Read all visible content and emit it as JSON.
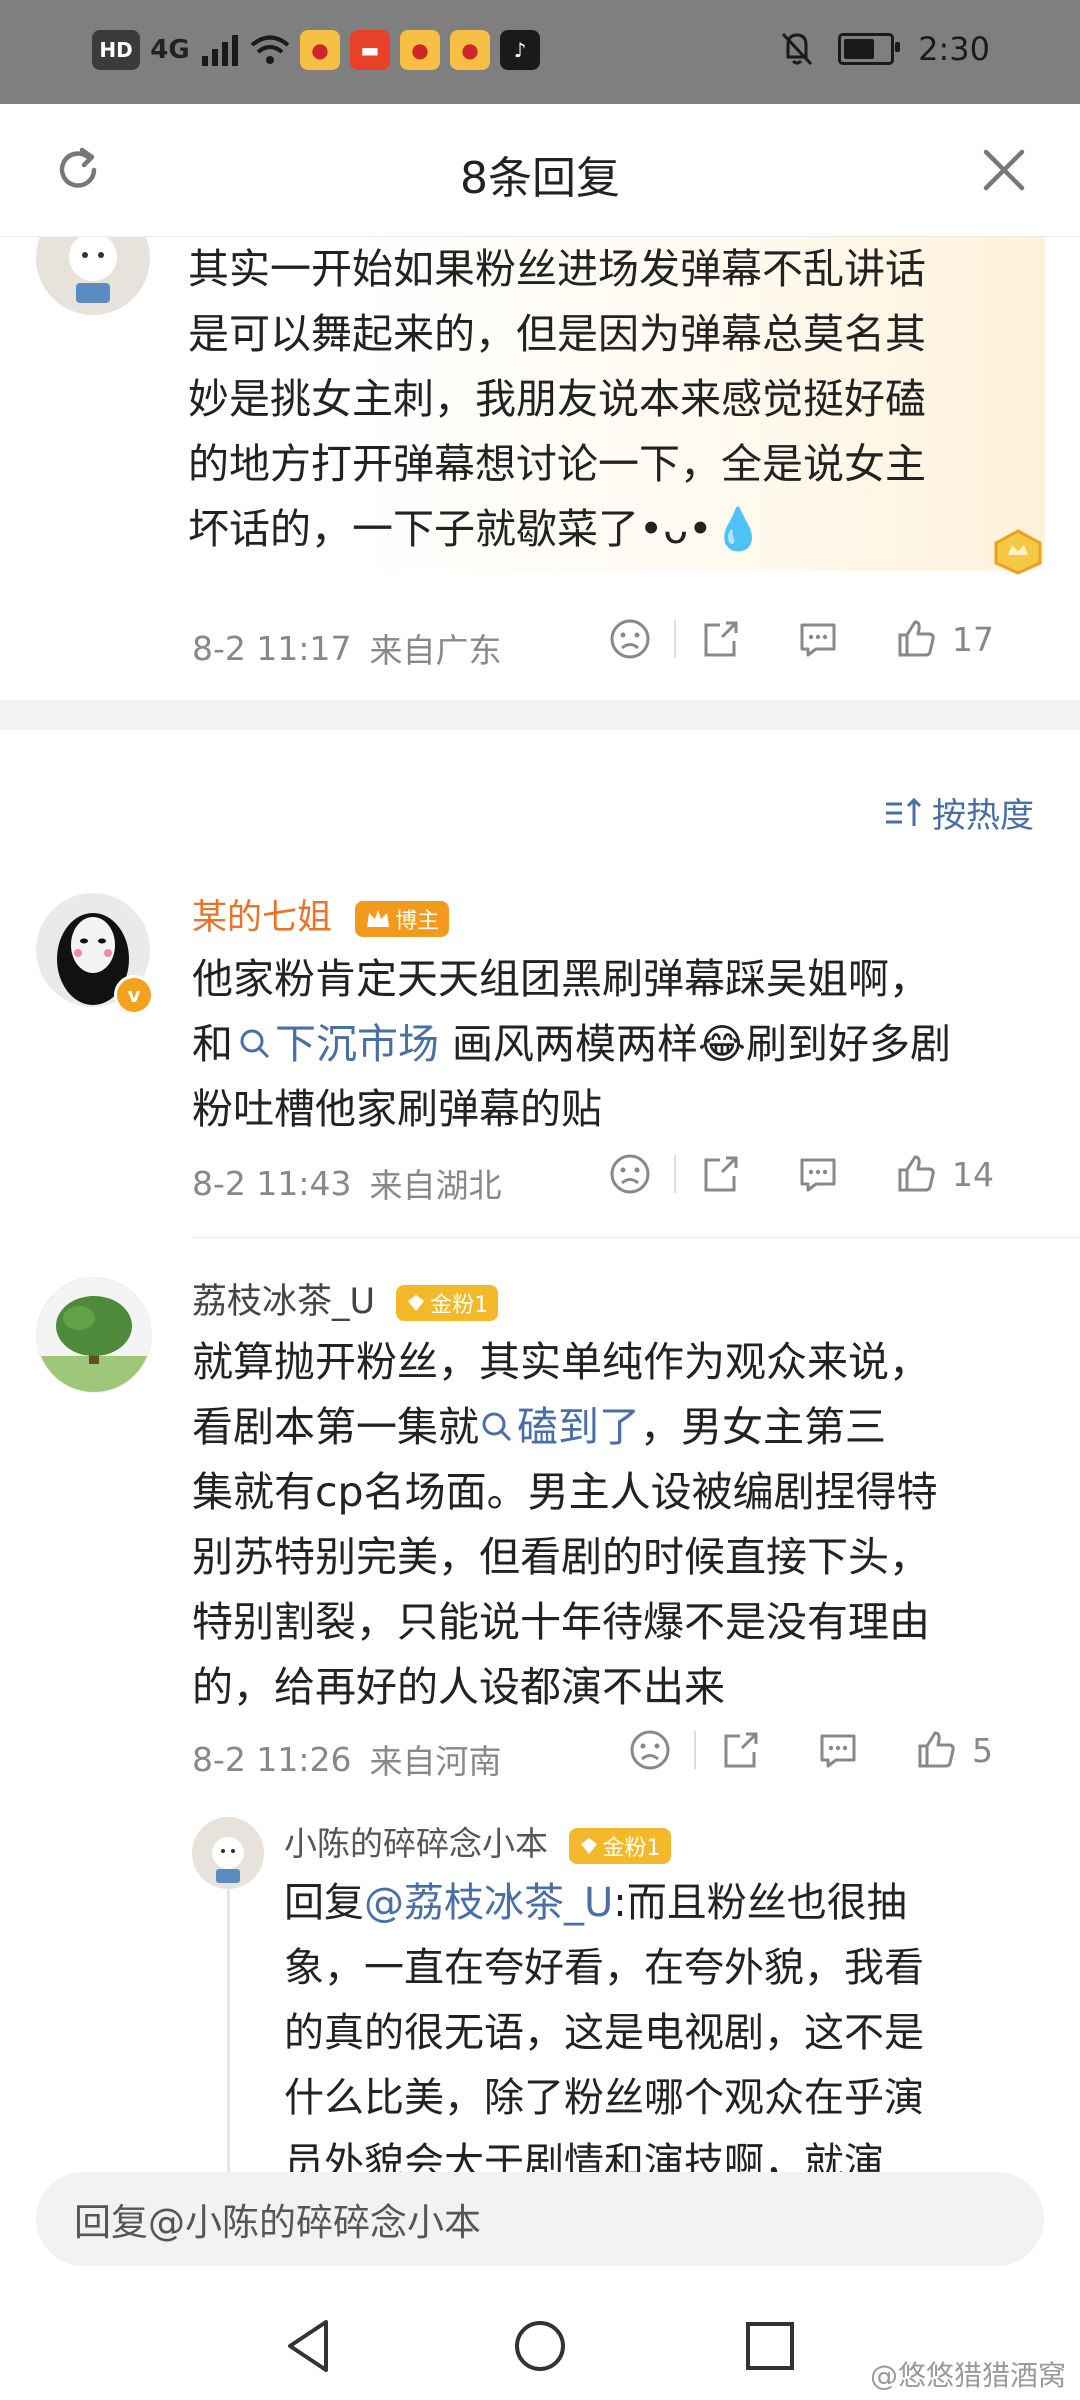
{
  "status_bar": {
    "hd": "HD",
    "network": "4G",
    "time": "2:30"
  },
  "sheet": {
    "title": "8条回复"
  },
  "comments": [
    {
      "text_lines": [
        "其实一开始如果粉丝进场发弹幕不乱讲话",
        "是可以舞起来的，但是因为弹幕总莫名其",
        "妙是挑女主刺，我朋友说本来感觉挺好磕",
        "的地方打开弹幕想讨论一下，全是说女主",
        "坏话的，一下子就歇菜了•ᴗ•💧"
      ],
      "date": "8-2 11:17",
      "location": "来自广东",
      "likes": "17"
    },
    {
      "username": "某的七姐",
      "badge": "博主",
      "text_line1": "他家粉肯定天天组团黑刷弹幕踩吴姐啊，",
      "text_line2_pre": "和",
      "text_line2_link": "下沉市场",
      "text_line2_post": " 画风两模两样😂刷到好多剧",
      "text_line3": "粉吐槽他家刷弹幕的贴",
      "date": "8-2 11:43",
      "location": "来自湖北",
      "likes": "14"
    },
    {
      "username": "荔枝冰茶_U",
      "badge": "金粉1",
      "text_line1": "就算抛开粉丝，其实单纯作为观众来说，",
      "text_line2_pre": "看剧本第一集就",
      "text_line2_link": "磕到了",
      "text_line2_post": "，男女主第三",
      "text_lines_rest": [
        "集就有cp名场面。男主人设被编剧捏得特",
        "别苏特别完美，但看剧的时候直接下头，",
        "特别割裂，只能说十年待爆不是没有理由",
        "的，给再好的人设都演不出来"
      ],
      "date": "8-2 11:26",
      "location": "来自河南",
      "likes": "5"
    },
    {
      "username": "小陈的碎碎念小本",
      "badge": "金粉1",
      "reply_prefix": "回复",
      "reply_mention": "@荔枝冰茶_U",
      "text_line1_post": ":而且粉丝也很抽",
      "text_lines_rest": [
        "象，一直在夸好看，在夸外貌，我看",
        "的真的很无语，这是电视剧，这不是",
        "什么比美，除了粉丝哪个观众在乎演",
        "员外貌会大于剧情和演技啊，就演"
      ]
    }
  ],
  "sort_label": "按热度",
  "reply_input": {
    "placeholder": "回复@小陈的碎碎念小本"
  },
  "watermark": "@悠悠猎猎酒窝"
}
